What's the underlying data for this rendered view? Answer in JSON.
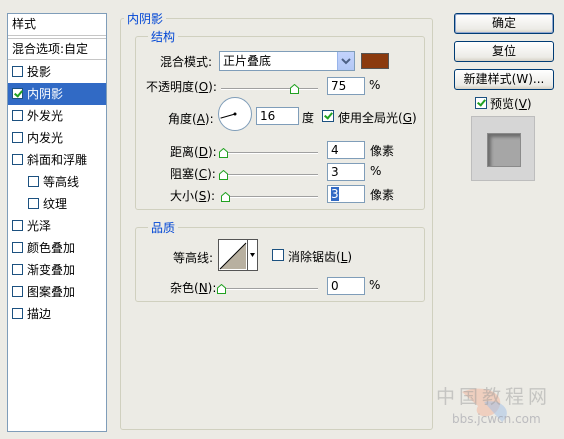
{
  "sidebar": {
    "header": "样式",
    "blend_options": "混合选项:自定",
    "items": [
      {
        "label": "投影",
        "checked": false,
        "selected": false,
        "indent": false
      },
      {
        "label": "内阴影",
        "checked": true,
        "selected": true,
        "indent": false
      },
      {
        "label": "外发光",
        "checked": false,
        "selected": false,
        "indent": false
      },
      {
        "label": "内发光",
        "checked": false,
        "selected": false,
        "indent": false
      },
      {
        "label": "斜面和浮雕",
        "checked": false,
        "selected": false,
        "indent": false
      },
      {
        "label": "等高线",
        "checked": false,
        "selected": false,
        "indent": true
      },
      {
        "label": "纹理",
        "checked": false,
        "selected": false,
        "indent": true
      },
      {
        "label": "光泽",
        "checked": false,
        "selected": false,
        "indent": false
      },
      {
        "label": "颜色叠加",
        "checked": false,
        "selected": false,
        "indent": false
      },
      {
        "label": "渐变叠加",
        "checked": false,
        "selected": false,
        "indent": false
      },
      {
        "label": "图案叠加",
        "checked": false,
        "selected": false,
        "indent": false
      },
      {
        "label": "描边",
        "checked": false,
        "selected": false,
        "indent": false
      }
    ]
  },
  "panel": {
    "title": "内阴影",
    "structure": {
      "title": "结构",
      "blend_mode_label": "混合模式:",
      "blend_mode_value": "正片叠底",
      "shadow_color": "#8b3a0e",
      "opacity_label_pre": "不透明度(",
      "opacity_key": "O",
      "opacity_label_post": "):",
      "opacity_value": "75",
      "opacity_level": 0.75,
      "percent": "%",
      "angle_label_pre": "角度(",
      "angle_key": "A",
      "angle_label_post": "):",
      "angle_value": "16",
      "angle_degrees": 16,
      "degree_unit": "度",
      "global_light_pre": "使用全局光(",
      "global_light_key": "G",
      "global_light_post": ")",
      "global_light_checked": true,
      "distance_label_pre": "距离(",
      "distance_key": "D",
      "distance_label_post": "):",
      "distance_value": "4",
      "choke_label_pre": "阻塞(",
      "choke_key": "C",
      "choke_label_post": "):",
      "choke_value": "3",
      "size_label_pre": "大小(",
      "size_key": "S",
      "size_label_post": "):",
      "size_value": "3",
      "pixel_unit": "像素"
    },
    "quality": {
      "title": "品质",
      "contour_label": "等高线:",
      "anti_alias_pre": "消除锯齿(",
      "anti_alias_key": "L",
      "anti_alias_post": ")",
      "anti_alias_checked": false,
      "noise_label_pre": "杂色(",
      "noise_key": "N",
      "noise_label_post": "):",
      "noise_value": "0",
      "percent": "%"
    }
  },
  "buttons": {
    "ok": "确定",
    "reset": "复位",
    "new_style": "新建样式(W)...",
    "preview_pre": "预览(",
    "preview_key": "V",
    "preview_post": ")",
    "preview_checked": true
  },
  "watermark": {
    "line1": "中国教程网",
    "line2": "bbs.jcwcn.com"
  }
}
